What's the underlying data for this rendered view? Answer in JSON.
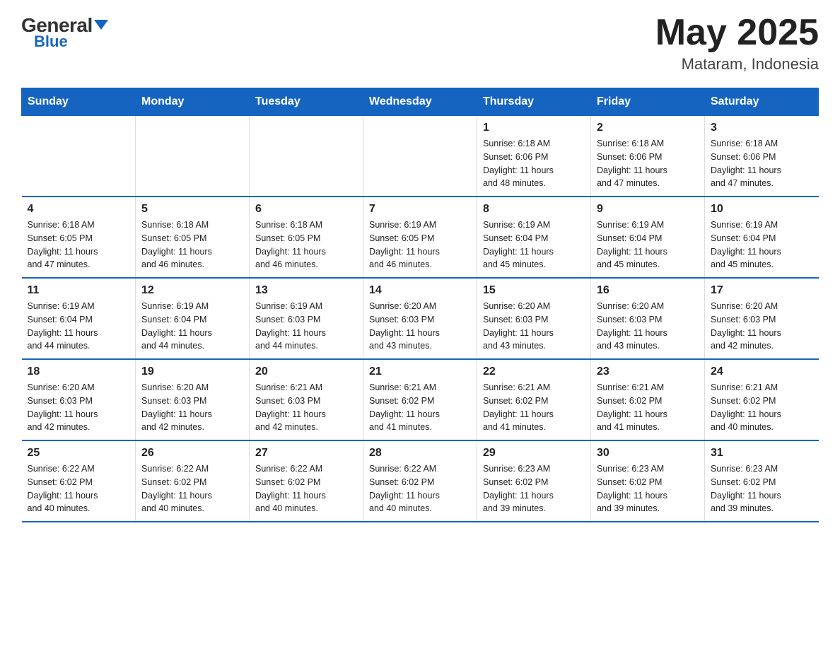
{
  "header": {
    "logo_general": "General",
    "logo_blue": "Blue",
    "month_year": "May 2025",
    "location": "Mataram, Indonesia"
  },
  "days_of_week": [
    "Sunday",
    "Monday",
    "Tuesday",
    "Wednesday",
    "Thursday",
    "Friday",
    "Saturday"
  ],
  "weeks": [
    [
      {
        "day": "",
        "info": ""
      },
      {
        "day": "",
        "info": ""
      },
      {
        "day": "",
        "info": ""
      },
      {
        "day": "",
        "info": ""
      },
      {
        "day": "1",
        "info": "Sunrise: 6:18 AM\nSunset: 6:06 PM\nDaylight: 11 hours\nand 48 minutes."
      },
      {
        "day": "2",
        "info": "Sunrise: 6:18 AM\nSunset: 6:06 PM\nDaylight: 11 hours\nand 47 minutes."
      },
      {
        "day": "3",
        "info": "Sunrise: 6:18 AM\nSunset: 6:06 PM\nDaylight: 11 hours\nand 47 minutes."
      }
    ],
    [
      {
        "day": "4",
        "info": "Sunrise: 6:18 AM\nSunset: 6:05 PM\nDaylight: 11 hours\nand 47 minutes."
      },
      {
        "day": "5",
        "info": "Sunrise: 6:18 AM\nSunset: 6:05 PM\nDaylight: 11 hours\nand 46 minutes."
      },
      {
        "day": "6",
        "info": "Sunrise: 6:18 AM\nSunset: 6:05 PM\nDaylight: 11 hours\nand 46 minutes."
      },
      {
        "day": "7",
        "info": "Sunrise: 6:19 AM\nSunset: 6:05 PM\nDaylight: 11 hours\nand 46 minutes."
      },
      {
        "day": "8",
        "info": "Sunrise: 6:19 AM\nSunset: 6:04 PM\nDaylight: 11 hours\nand 45 minutes."
      },
      {
        "day": "9",
        "info": "Sunrise: 6:19 AM\nSunset: 6:04 PM\nDaylight: 11 hours\nand 45 minutes."
      },
      {
        "day": "10",
        "info": "Sunrise: 6:19 AM\nSunset: 6:04 PM\nDaylight: 11 hours\nand 45 minutes."
      }
    ],
    [
      {
        "day": "11",
        "info": "Sunrise: 6:19 AM\nSunset: 6:04 PM\nDaylight: 11 hours\nand 44 minutes."
      },
      {
        "day": "12",
        "info": "Sunrise: 6:19 AM\nSunset: 6:04 PM\nDaylight: 11 hours\nand 44 minutes."
      },
      {
        "day": "13",
        "info": "Sunrise: 6:19 AM\nSunset: 6:03 PM\nDaylight: 11 hours\nand 44 minutes."
      },
      {
        "day": "14",
        "info": "Sunrise: 6:20 AM\nSunset: 6:03 PM\nDaylight: 11 hours\nand 43 minutes."
      },
      {
        "day": "15",
        "info": "Sunrise: 6:20 AM\nSunset: 6:03 PM\nDaylight: 11 hours\nand 43 minutes."
      },
      {
        "day": "16",
        "info": "Sunrise: 6:20 AM\nSunset: 6:03 PM\nDaylight: 11 hours\nand 43 minutes."
      },
      {
        "day": "17",
        "info": "Sunrise: 6:20 AM\nSunset: 6:03 PM\nDaylight: 11 hours\nand 42 minutes."
      }
    ],
    [
      {
        "day": "18",
        "info": "Sunrise: 6:20 AM\nSunset: 6:03 PM\nDaylight: 11 hours\nand 42 minutes."
      },
      {
        "day": "19",
        "info": "Sunrise: 6:20 AM\nSunset: 6:03 PM\nDaylight: 11 hours\nand 42 minutes."
      },
      {
        "day": "20",
        "info": "Sunrise: 6:21 AM\nSunset: 6:03 PM\nDaylight: 11 hours\nand 42 minutes."
      },
      {
        "day": "21",
        "info": "Sunrise: 6:21 AM\nSunset: 6:02 PM\nDaylight: 11 hours\nand 41 minutes."
      },
      {
        "day": "22",
        "info": "Sunrise: 6:21 AM\nSunset: 6:02 PM\nDaylight: 11 hours\nand 41 minutes."
      },
      {
        "day": "23",
        "info": "Sunrise: 6:21 AM\nSunset: 6:02 PM\nDaylight: 11 hours\nand 41 minutes."
      },
      {
        "day": "24",
        "info": "Sunrise: 6:21 AM\nSunset: 6:02 PM\nDaylight: 11 hours\nand 40 minutes."
      }
    ],
    [
      {
        "day": "25",
        "info": "Sunrise: 6:22 AM\nSunset: 6:02 PM\nDaylight: 11 hours\nand 40 minutes."
      },
      {
        "day": "26",
        "info": "Sunrise: 6:22 AM\nSunset: 6:02 PM\nDaylight: 11 hours\nand 40 minutes."
      },
      {
        "day": "27",
        "info": "Sunrise: 6:22 AM\nSunset: 6:02 PM\nDaylight: 11 hours\nand 40 minutes."
      },
      {
        "day": "28",
        "info": "Sunrise: 6:22 AM\nSunset: 6:02 PM\nDaylight: 11 hours\nand 40 minutes."
      },
      {
        "day": "29",
        "info": "Sunrise: 6:23 AM\nSunset: 6:02 PM\nDaylight: 11 hours\nand 39 minutes."
      },
      {
        "day": "30",
        "info": "Sunrise: 6:23 AM\nSunset: 6:02 PM\nDaylight: 11 hours\nand 39 minutes."
      },
      {
        "day": "31",
        "info": "Sunrise: 6:23 AM\nSunset: 6:02 PM\nDaylight: 11 hours\nand 39 minutes."
      }
    ]
  ]
}
